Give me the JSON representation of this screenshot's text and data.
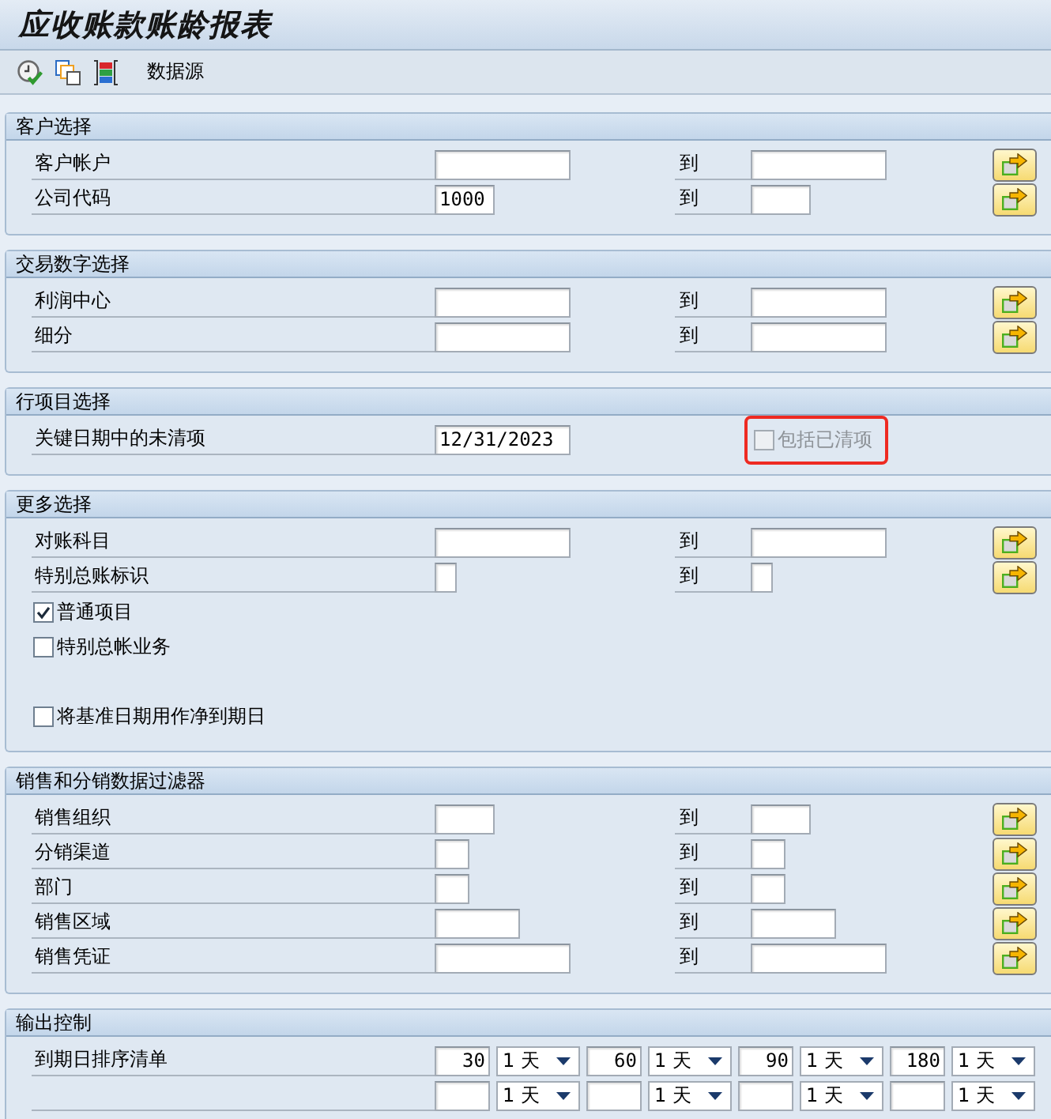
{
  "window": {
    "title": "应收账款账龄报表"
  },
  "toolbar": {
    "buttons": [
      {
        "label": "数据源"
      }
    ]
  },
  "groups": [
    {
      "title": "客户选择",
      "rows": [
        {
          "kind": "range",
          "label": "客户帐户",
          "to_label": "到"
        },
        {
          "kind": "range",
          "label": "公司代码",
          "from": "1000",
          "to_label": "到"
        }
      ]
    },
    {
      "title": "交易数字选择",
      "rows": [
        {
          "kind": "range",
          "label": "利润中心",
          "to_label": "到"
        },
        {
          "kind": "range",
          "label": "细分",
          "to_label": "到"
        }
      ]
    },
    {
      "title": "行项目选择",
      "rows": [
        {
          "kind": "single",
          "label": "关键日期中的未清项",
          "value": "12/31/2023",
          "option": {
            "label": "包括已清项",
            "checked": false,
            "disabled": true,
            "highlighted": true
          }
        }
      ]
    },
    {
      "title": "更多选择",
      "rows": [
        {
          "kind": "range",
          "label": "对账科目",
          "to_label": "到"
        },
        {
          "kind": "range",
          "label": "特别总账标识",
          "to_label": "到"
        },
        {
          "kind": "checkbox",
          "label": "普通项目",
          "checked": true,
          "disabled": false
        },
        {
          "kind": "checkbox",
          "label": "特别总帐业务",
          "checked": false,
          "disabled": false
        },
        {
          "kind": "checkbox",
          "label": "将基准日期用作净到期日",
          "checked": false,
          "disabled": false
        }
      ]
    },
    {
      "title": "销售和分销数据过滤器",
      "rows": [
        {
          "kind": "range",
          "label": "销售组织",
          "to_label": "到"
        },
        {
          "kind": "range",
          "label": "分销渠道",
          "to_label": "到"
        },
        {
          "kind": "range",
          "label": "部门",
          "to_label": "到"
        },
        {
          "kind": "range",
          "label": "销售区域",
          "to_label": "到"
        },
        {
          "kind": "range",
          "label": "销售凭证",
          "to_label": "到"
        }
      ]
    },
    {
      "title": "输出控制",
      "rows": [
        {
          "kind": "intervals",
          "label": "到期日排序清单",
          "cells": [
            {
              "value": "30",
              "unit": "1 天"
            },
            {
              "value": "60",
              "unit": "1 天"
            },
            {
              "value": "90",
              "unit": "1 天"
            },
            {
              "value": "180",
              "unit": "1 天"
            }
          ]
        },
        {
          "kind": "intervals",
          "cells": [
            {
              "unit": "1 天"
            },
            {
              "unit": "1 天"
            },
            {
              "unit": "1 天"
            },
            {
              "unit": "1 天"
            }
          ]
        }
      ]
    }
  ]
}
